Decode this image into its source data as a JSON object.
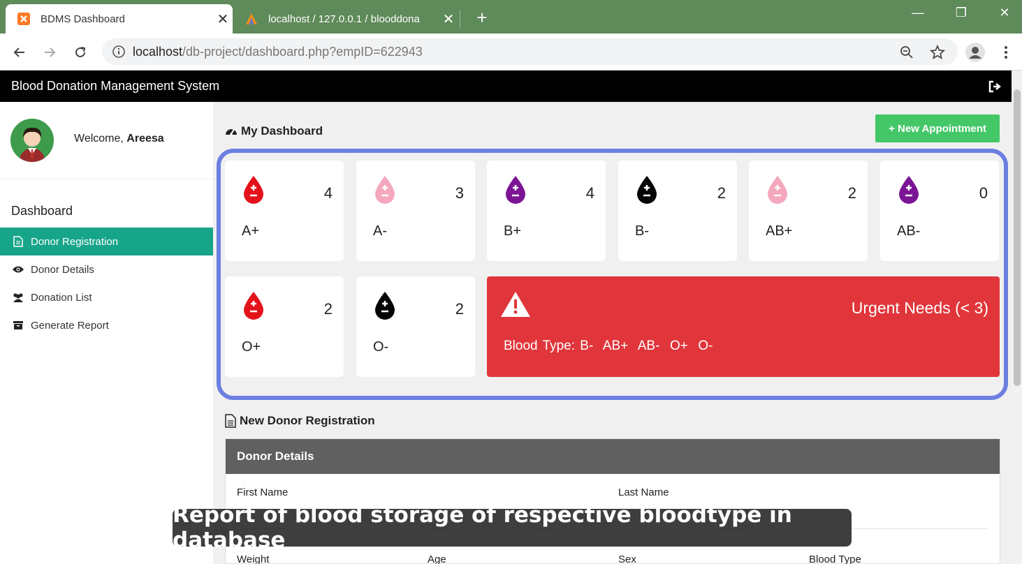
{
  "browser": {
    "tabs": [
      {
        "title": "BDMS Dashboard",
        "active": true
      },
      {
        "title": "localhost / 127.0.0.1 / blooddona",
        "active": false
      }
    ],
    "new_tab": "+",
    "close": "✕",
    "url_host": "localhost",
    "url_rest": "/db-project/dashboard.php?empID=622943"
  },
  "app": {
    "title": "Blood Donation Management System"
  },
  "sidebar": {
    "welcome_prefix": "Welcome, ",
    "user_name": "Areesa",
    "heading": "Dashboard",
    "items": [
      {
        "label": "Donor Registration",
        "icon": "document-icon",
        "active": true
      },
      {
        "label": "Donor Details",
        "icon": "eye-icon",
        "active": false
      },
      {
        "label": "Donation List",
        "icon": "users-icon",
        "active": false
      },
      {
        "label": "Generate Report",
        "icon": "archive-icon",
        "active": false
      }
    ]
  },
  "dashboard": {
    "title": "My Dashboard",
    "new_appointment": "+ New Appointment",
    "cards": [
      {
        "type": "A+",
        "count": "4",
        "color": "#e3121b"
      },
      {
        "type": "A-",
        "count": "3",
        "color": "#f5a7bd"
      },
      {
        "type": "B+",
        "count": "4",
        "color": "#7b1595"
      },
      {
        "type": "B-",
        "count": "2",
        "color": "#050505"
      },
      {
        "type": "AB+",
        "count": "2",
        "color": "#f5a7bd"
      },
      {
        "type": "AB-",
        "count": "0",
        "color": "#7b1595"
      },
      {
        "type": "O+",
        "count": "2",
        "color": "#e3121b"
      },
      {
        "type": "O-",
        "count": "2",
        "color": "#050505"
      }
    ],
    "urgent": {
      "title": "Urgent Needs (< 3)",
      "types": "Blood Type: B-  AB+  AB-  O+  O-",
      "color": "#e0353a"
    }
  },
  "registration": {
    "title": "New Donor Registration",
    "panel_title": "Donor Details",
    "fields": {
      "first_name": "First Name",
      "last_name": "Last Name",
      "weight": "Weight",
      "age": "Age",
      "sex": "Sex",
      "blood_type": "Blood Type"
    }
  },
  "caption": "Report of blood storage of respective bloodtype in database"
}
